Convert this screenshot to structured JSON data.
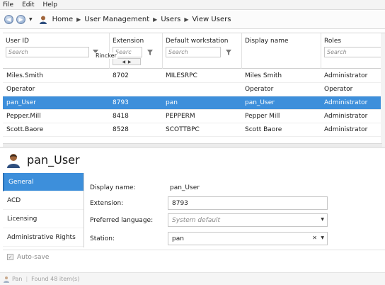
{
  "menu": {
    "file": "File",
    "edit": "Edit",
    "help": "Help"
  },
  "breadcrumb": {
    "home": "Home",
    "user_management": "User Management",
    "users": "Users",
    "view_users": "View Users"
  },
  "grid": {
    "columns": [
      {
        "label": "User ID",
        "placeholder": "Search"
      },
      {
        "label": "Extension",
        "placeholder": "Searc"
      },
      {
        "label": "Default workstation",
        "placeholder": "Search"
      },
      {
        "label": "Display name",
        "placeholder": ""
      },
      {
        "label": "Roles",
        "placeholder": "Search"
      }
    ],
    "popup_text": "Rincker",
    "rows": [
      {
        "user_id": "Miles.Smith",
        "extension": "8702",
        "workstation": "MILESRPC",
        "display_name": "Miles Smith",
        "roles": "Administrator"
      },
      {
        "user_id": "Operator",
        "extension": "",
        "workstation": "",
        "display_name": "Operator",
        "roles": "Operator"
      },
      {
        "user_id": "pan_User",
        "extension": "8793",
        "workstation": "pan",
        "display_name": "pan_User",
        "roles": "Administrator"
      },
      {
        "user_id": "Pepper.Mill",
        "extension": "8418",
        "workstation": "PEPPERM",
        "display_name": "Pepper Mill",
        "roles": "Administrator"
      },
      {
        "user_id": "Scott.Baore",
        "extension": "8528",
        "workstation": "SCOTTBPC",
        "display_name": "Scott Baore",
        "roles": "Administrator"
      }
    ],
    "selected_row": 2
  },
  "detail": {
    "title": "pan_User",
    "tabs": [
      "General",
      "ACD",
      "Licensing",
      "Administrative Rights"
    ],
    "active_tab": "General",
    "form": {
      "display_name_label": "Display name:",
      "display_name_value": "pan_User",
      "extension_label": "Extension:",
      "extension_value": "8793",
      "language_label": "Preferred language:",
      "language_placeholder": "System default",
      "station_label": "Station:",
      "station_value": "pan"
    }
  },
  "autosave": {
    "label": "Auto-save",
    "checked": true
  },
  "status": {
    "left": "Pan",
    "count": "Found 48 item(s)"
  },
  "colors": {
    "selection": "#3d8fdb",
    "accent": "#2a70b7"
  }
}
